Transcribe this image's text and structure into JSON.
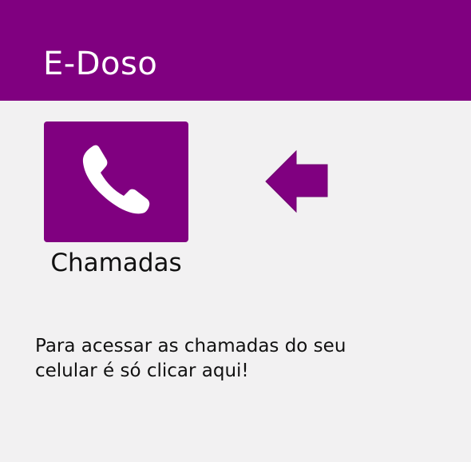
{
  "app": {
    "title": "E-Doso"
  },
  "tile": {
    "label": "Chamadas",
    "icon": "phone-icon"
  },
  "pointer": {
    "icon": "arrow-left-icon"
  },
  "hint": {
    "text": "Para acessar as chamadas do seu celular é só clicar aqui!"
  },
  "colors": {
    "primary": "#800080",
    "background": "#f2f1f2",
    "on_primary": "#ffffff",
    "text": "#111111"
  }
}
